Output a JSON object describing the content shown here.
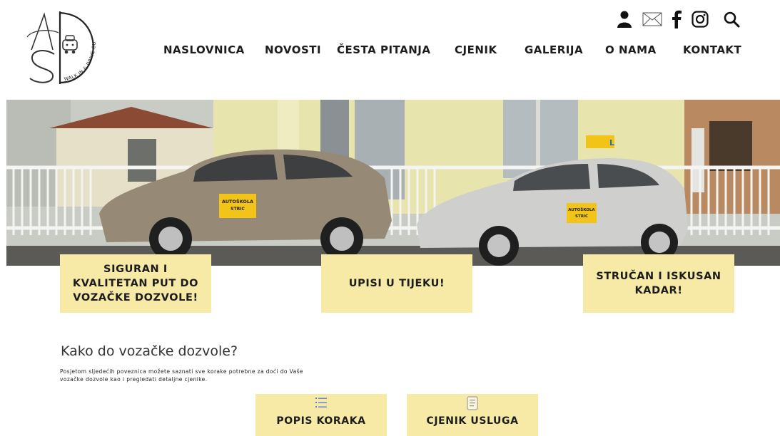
{
  "logo": {
    "letters": "AS",
    "tagline": "WALK IN & DRIVE OUT"
  },
  "utility": {
    "icons": [
      "user-icon",
      "mail-icon",
      "facebook-icon",
      "instagram-icon",
      "search-icon"
    ]
  },
  "nav": {
    "items": [
      {
        "label": "NASLOVNICA"
      },
      {
        "label": "NOVOSTI"
      },
      {
        "label": "ČESTA PITANJA"
      },
      {
        "label": "CJENIK"
      },
      {
        "label": "GALERIJA"
      },
      {
        "label": "O NAMA"
      },
      {
        "label": "KONTAKT"
      }
    ]
  },
  "hero": {
    "car_signs": [
      {
        "title": "AUTOŠKOLA",
        "name": "STRIC"
      },
      {
        "title": "AUTOŠKOLA",
        "name": "STRIC"
      }
    ],
    "roof_sign": "L"
  },
  "features": [
    {
      "label": "SIGURAN I KVALITETAN PUT DO VOZAČKE DOZVOLE!"
    },
    {
      "label": "UPISI U TIJEKU!"
    },
    {
      "label": "STRUČAN I ISKUSAN KADAR!"
    }
  ],
  "info": {
    "title": "Kako do vozačke dozvole?",
    "description": "Posjetom sljedećih poveznica  možete saznati sve korake potrebne  za doći do Vaše vozačke dozvole kao i pregledati detaljne cjenike."
  },
  "cta": [
    {
      "label": "POPIS KORAKA",
      "icon": "list-icon"
    },
    {
      "label": "CJENIK USLUGA",
      "icon": "document-icon"
    }
  ],
  "colors": {
    "accent": "#f7e9a6",
    "text": "#1d1d1d"
  }
}
